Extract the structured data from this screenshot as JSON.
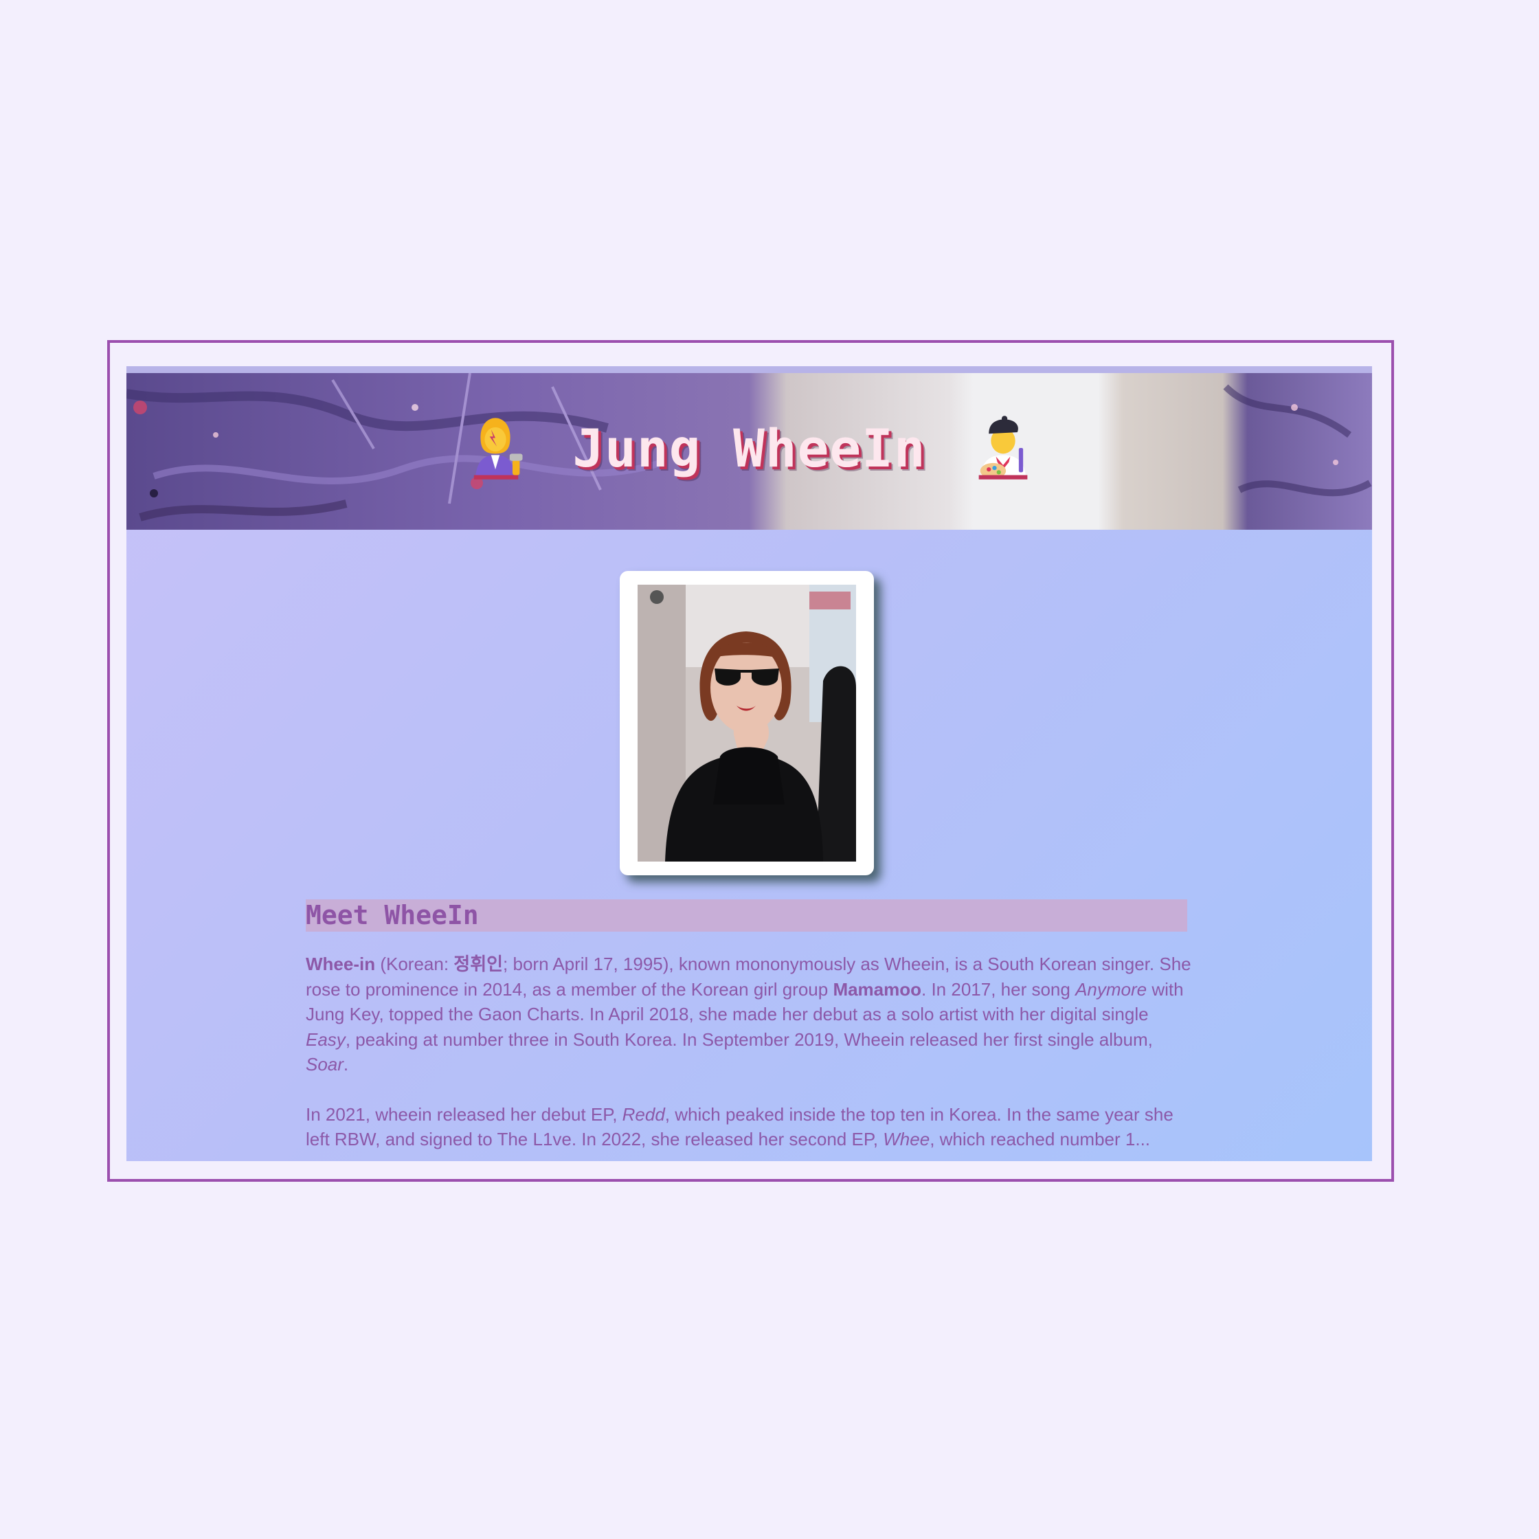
{
  "banner": {
    "title": "Jung WheeIn",
    "left_icon": "woman-singer-icon",
    "right_icon": "woman-artist-icon"
  },
  "photo": {
    "subject": "photo-of-wheein-in-sunglasses"
  },
  "section": {
    "heading": "Meet WheeIn"
  },
  "bio": {
    "p1": {
      "name": "Whee-in",
      "s1": " (Korean: ",
      "korean": "정휘인",
      "s2": "; born April 17, 1995), known mononymously as Wheein, is a South Korean singer. She rose to prominence in 2014, as a member of the Korean girl group ",
      "group": "Mamamoo",
      "s3": ". In 2017, her song ",
      "song1": "Anymore",
      "s4": " with Jung Key, topped the Gaon Charts. In April 2018, she made her debut as a solo artist with her digital single ",
      "song2": "Easy",
      "s5": ", peaking at number three in South Korea. In September 2019, Wheein released her first single album, ",
      "album": "Soar",
      "s6": "."
    },
    "p2": {
      "s1": "In 2021, wheein released her debut EP, ",
      "ep": "Redd",
      "s2": ", which peaked inside the top ten in Korea. In the same year she left RBW, and signed to The L1ve. In 2022, she released her second EP, ",
      "ep2": "Whee",
      "s3": ", which reached number 1..."
    }
  },
  "colors": {
    "page_bg": "#f3effd",
    "frame_border": "#9b4fae",
    "heading_bg": "#c8aed7",
    "text": "#8c58a8",
    "title_text": "#fde7ee",
    "title_shadow": "#c0335a"
  }
}
